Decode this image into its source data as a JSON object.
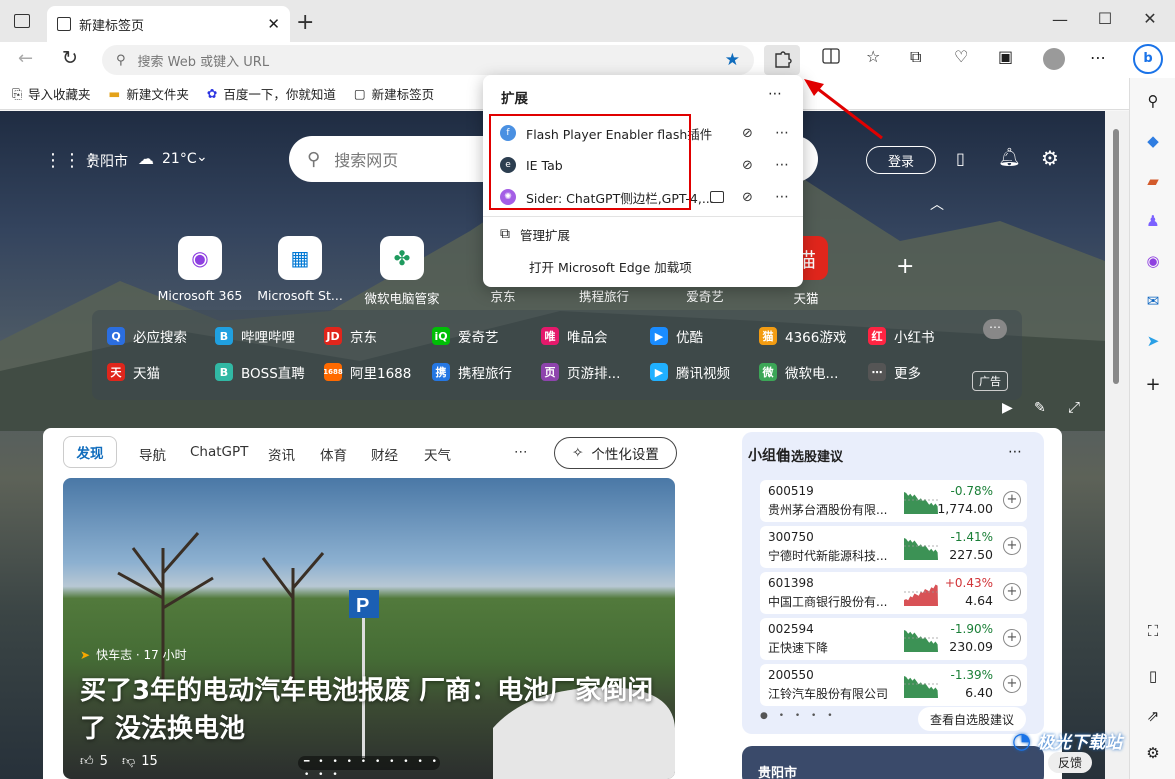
{
  "browser": {
    "tab_title": "新建标签页",
    "address_placeholder": "搜索 Web 或键入 URL"
  },
  "favorites_bar": [
    {
      "label": "导入收藏夹",
      "icon": "import-icon"
    },
    {
      "label": "新建文件夹",
      "icon": "folder-icon"
    },
    {
      "label": "百度一下，你就知道",
      "icon": "baidu-icon"
    },
    {
      "label": "新建标签页",
      "icon": "newtab-icon"
    }
  ],
  "page": {
    "city": "贵阳市",
    "temperature": "21°C",
    "search_placeholder": "搜索网页",
    "login": "登录",
    "quick_links": [
      "Microsoft 365",
      "Microsoft St...",
      "微软电脑管家",
      "京东",
      "携程旅行",
      "爱奇艺",
      "天猫"
    ],
    "links_row1": [
      "必应搜索",
      "哔哩哔哩",
      "京东",
      "爱奇艺",
      "唯品会",
      "优酷",
      "4366游戏",
      "小红书"
    ],
    "links_row2": [
      "天猫",
      "BOSS直聘",
      "阿里1688",
      "携程旅行",
      "页游排...",
      "腾讯视频",
      "微软电...",
      "更多"
    ],
    "ad_label": "广告",
    "link_icons_row1": [
      {
        "t": "Q",
        "c": "#2b6ee0"
      },
      {
        "t": "B",
        "c": "#20a0e0"
      },
      {
        "t": "JD",
        "c": "#e1251b"
      },
      {
        "t": "iQ",
        "c": "#00be06"
      },
      {
        "t": "唯",
        "c": "#e5196b"
      },
      {
        "t": "▶",
        "c": "#1a8cff"
      },
      {
        "t": "猫",
        "c": "#f39c12"
      },
      {
        "t": "红",
        "c": "#ff2442"
      }
    ],
    "link_icons_row2": [
      {
        "t": "天",
        "c": "#e0261c"
      },
      {
        "t": "B",
        "c": "#31b8a4"
      },
      {
        "t": "1688",
        "c": "#ff6a00"
      },
      {
        "t": "携",
        "c": "#2577e3"
      },
      {
        "t": "页",
        "c": "#8e44ad"
      },
      {
        "t": "▶",
        "c": "#20b0ff"
      },
      {
        "t": "微",
        "c": "#3ca657"
      },
      {
        "t": "⋯",
        "c": "#555"
      }
    ]
  },
  "feed": {
    "tabs": [
      "发现",
      "导航",
      "ChatGPT",
      "资讯",
      "体育",
      "财经",
      "天气"
    ],
    "personalize": "个性化设置",
    "source": "快车志 · 17 小时",
    "headline": "买了3年的电动汽车电池报废 厂商：电池厂家倒闭了 没法换电池",
    "likes": "5",
    "dislikes": "15"
  },
  "widget": {
    "title": "小组件",
    "subtitle": "自选股建议",
    "stocks": [
      {
        "code": "600519",
        "name": "贵州茅台酒股份有限...",
        "change": "-0.78%",
        "price": "1,774.00",
        "up": false
      },
      {
        "code": "300750",
        "name": "宁德时代新能源科技...",
        "change": "-1.41%",
        "price": "227.50",
        "up": false
      },
      {
        "code": "601398",
        "name": "中国工商银行股份有...",
        "change": "+0.43%",
        "price": "4.64",
        "up": true
      },
      {
        "code": "002594",
        "name": "正快速下降",
        "change": "-1.90%",
        "price": "230.09",
        "up": false
      },
      {
        "code": "200550",
        "name": "江铃汽车股份有限公司",
        "change": "-1.39%",
        "price": "6.40",
        "up": false
      }
    ],
    "watchlist_button": "查看自选股建议",
    "weather_city": "贵阳市"
  },
  "extensions_popup": {
    "title": "扩展",
    "items": [
      {
        "name": "Flash Player Enabler flash插件"
      },
      {
        "name": "IE Tab"
      },
      {
        "name": "Sider: ChatGPT侧边栏,GPT-4,..."
      }
    ],
    "manage": "管理扩展",
    "open_addons": "打开 Microsoft Edge 加载项"
  },
  "feedback": "反馈",
  "watermark": "极光下载站",
  "colors": {
    "accent": "#0f6cbd",
    "highlight_box": "#e00000",
    "down": "#1a7f37",
    "up": "#d13438"
  }
}
